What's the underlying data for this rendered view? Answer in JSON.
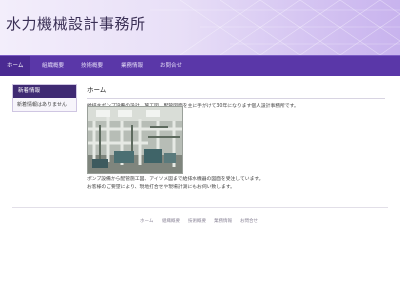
{
  "site": {
    "title": "水力機械設計事務所"
  },
  "nav": {
    "items": [
      {
        "label": "ホーム"
      },
      {
        "label": "組織概要"
      },
      {
        "label": "技術概要"
      },
      {
        "label": "業務情報"
      },
      {
        "label": "お問合せ"
      }
    ]
  },
  "sidebar": {
    "heading": "新着情報",
    "empty_text": "新着情報はありません"
  },
  "main": {
    "title": "ホーム",
    "intro": "給排水ポンプ設備の設計、施工図、配管図面を主に手がけて30年になります個人設計事務所です。",
    "line1": "ポンプ設備から配管施工図、アイソメ図まで給排水機器の図面を受注しています。",
    "line2": "お客様のご要望により、現地打合せや現場計測にもお伺い致します。"
  },
  "footer": {
    "items": [
      "ホーム",
      "組織概要",
      "技術概要",
      "業務情報",
      "お問合せ"
    ]
  },
  "colors": {
    "nav_bg": "#5a37a8",
    "nav_active": "#4a2a92",
    "sidebar_head": "#3f2a73",
    "header_gradient_end": "#c8b3ee"
  }
}
